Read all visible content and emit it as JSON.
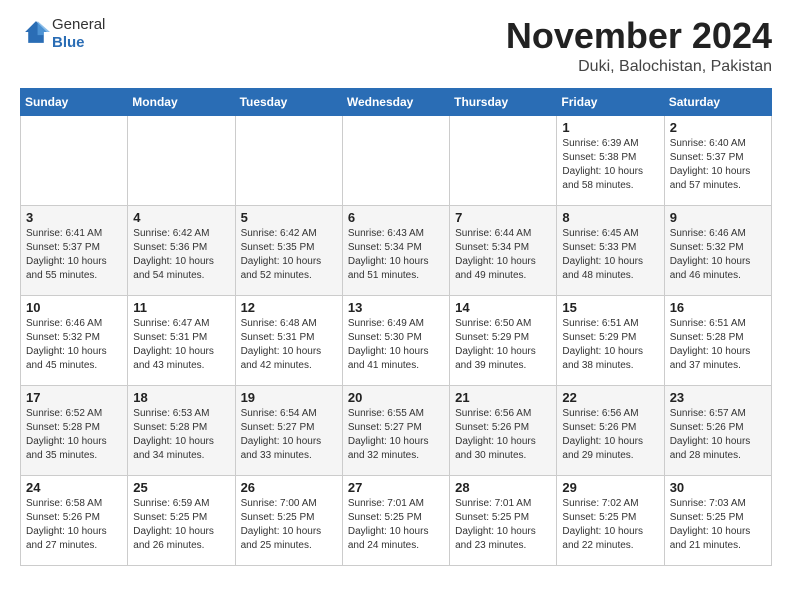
{
  "header": {
    "logo_general": "General",
    "logo_blue": "Blue",
    "month_title": "November 2024",
    "location": "Duki, Balochistan, Pakistan"
  },
  "days_of_week": [
    "Sunday",
    "Monday",
    "Tuesday",
    "Wednesday",
    "Thursday",
    "Friday",
    "Saturday"
  ],
  "weeks": [
    [
      {
        "day": "",
        "info": ""
      },
      {
        "day": "",
        "info": ""
      },
      {
        "day": "",
        "info": ""
      },
      {
        "day": "",
        "info": ""
      },
      {
        "day": "",
        "info": ""
      },
      {
        "day": "1",
        "info": "Sunrise: 6:39 AM\nSunset: 5:38 PM\nDaylight: 10 hours\nand 58 minutes."
      },
      {
        "day": "2",
        "info": "Sunrise: 6:40 AM\nSunset: 5:37 PM\nDaylight: 10 hours\nand 57 minutes."
      }
    ],
    [
      {
        "day": "3",
        "info": "Sunrise: 6:41 AM\nSunset: 5:37 PM\nDaylight: 10 hours\nand 55 minutes."
      },
      {
        "day": "4",
        "info": "Sunrise: 6:42 AM\nSunset: 5:36 PM\nDaylight: 10 hours\nand 54 minutes."
      },
      {
        "day": "5",
        "info": "Sunrise: 6:42 AM\nSunset: 5:35 PM\nDaylight: 10 hours\nand 52 minutes."
      },
      {
        "day": "6",
        "info": "Sunrise: 6:43 AM\nSunset: 5:34 PM\nDaylight: 10 hours\nand 51 minutes."
      },
      {
        "day": "7",
        "info": "Sunrise: 6:44 AM\nSunset: 5:34 PM\nDaylight: 10 hours\nand 49 minutes."
      },
      {
        "day": "8",
        "info": "Sunrise: 6:45 AM\nSunset: 5:33 PM\nDaylight: 10 hours\nand 48 minutes."
      },
      {
        "day": "9",
        "info": "Sunrise: 6:46 AM\nSunset: 5:32 PM\nDaylight: 10 hours\nand 46 minutes."
      }
    ],
    [
      {
        "day": "10",
        "info": "Sunrise: 6:46 AM\nSunset: 5:32 PM\nDaylight: 10 hours\nand 45 minutes."
      },
      {
        "day": "11",
        "info": "Sunrise: 6:47 AM\nSunset: 5:31 PM\nDaylight: 10 hours\nand 43 minutes."
      },
      {
        "day": "12",
        "info": "Sunrise: 6:48 AM\nSunset: 5:31 PM\nDaylight: 10 hours\nand 42 minutes."
      },
      {
        "day": "13",
        "info": "Sunrise: 6:49 AM\nSunset: 5:30 PM\nDaylight: 10 hours\nand 41 minutes."
      },
      {
        "day": "14",
        "info": "Sunrise: 6:50 AM\nSunset: 5:29 PM\nDaylight: 10 hours\nand 39 minutes."
      },
      {
        "day": "15",
        "info": "Sunrise: 6:51 AM\nSunset: 5:29 PM\nDaylight: 10 hours\nand 38 minutes."
      },
      {
        "day": "16",
        "info": "Sunrise: 6:51 AM\nSunset: 5:28 PM\nDaylight: 10 hours\nand 37 minutes."
      }
    ],
    [
      {
        "day": "17",
        "info": "Sunrise: 6:52 AM\nSunset: 5:28 PM\nDaylight: 10 hours\nand 35 minutes."
      },
      {
        "day": "18",
        "info": "Sunrise: 6:53 AM\nSunset: 5:28 PM\nDaylight: 10 hours\nand 34 minutes."
      },
      {
        "day": "19",
        "info": "Sunrise: 6:54 AM\nSunset: 5:27 PM\nDaylight: 10 hours\nand 33 minutes."
      },
      {
        "day": "20",
        "info": "Sunrise: 6:55 AM\nSunset: 5:27 PM\nDaylight: 10 hours\nand 32 minutes."
      },
      {
        "day": "21",
        "info": "Sunrise: 6:56 AM\nSunset: 5:26 PM\nDaylight: 10 hours\nand 30 minutes."
      },
      {
        "day": "22",
        "info": "Sunrise: 6:56 AM\nSunset: 5:26 PM\nDaylight: 10 hours\nand 29 minutes."
      },
      {
        "day": "23",
        "info": "Sunrise: 6:57 AM\nSunset: 5:26 PM\nDaylight: 10 hours\nand 28 minutes."
      }
    ],
    [
      {
        "day": "24",
        "info": "Sunrise: 6:58 AM\nSunset: 5:26 PM\nDaylight: 10 hours\nand 27 minutes."
      },
      {
        "day": "25",
        "info": "Sunrise: 6:59 AM\nSunset: 5:25 PM\nDaylight: 10 hours\nand 26 minutes."
      },
      {
        "day": "26",
        "info": "Sunrise: 7:00 AM\nSunset: 5:25 PM\nDaylight: 10 hours\nand 25 minutes."
      },
      {
        "day": "27",
        "info": "Sunrise: 7:01 AM\nSunset: 5:25 PM\nDaylight: 10 hours\nand 24 minutes."
      },
      {
        "day": "28",
        "info": "Sunrise: 7:01 AM\nSunset: 5:25 PM\nDaylight: 10 hours\nand 23 minutes."
      },
      {
        "day": "29",
        "info": "Sunrise: 7:02 AM\nSunset: 5:25 PM\nDaylight: 10 hours\nand 22 minutes."
      },
      {
        "day": "30",
        "info": "Sunrise: 7:03 AM\nSunset: 5:25 PM\nDaylight: 10 hours\nand 21 minutes."
      }
    ]
  ]
}
